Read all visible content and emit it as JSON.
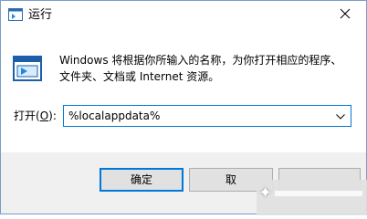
{
  "window": {
    "title": "运行",
    "title_icon": "run-icon",
    "close_icon": "close-icon"
  },
  "content": {
    "icon": "run-dialog-icon",
    "description_line1": "Windows 将根据你所输入的名称，为你打开相应的程序、",
    "description_line2": "文件夹、文档或 Internet 资源。"
  },
  "open_field": {
    "label_prefix": "打开(",
    "label_accel": "O",
    "label_suffix": "):",
    "value": "%localappdata%",
    "dropdown_icon": "chevron-down-icon"
  },
  "buttons": {
    "ok": "确定",
    "cancel": "取",
    "browse": ""
  },
  "colors": {
    "accent": "#0078d7",
    "footer_bg": "#f0f0f0",
    "button_bg": "#e1e1e1"
  }
}
